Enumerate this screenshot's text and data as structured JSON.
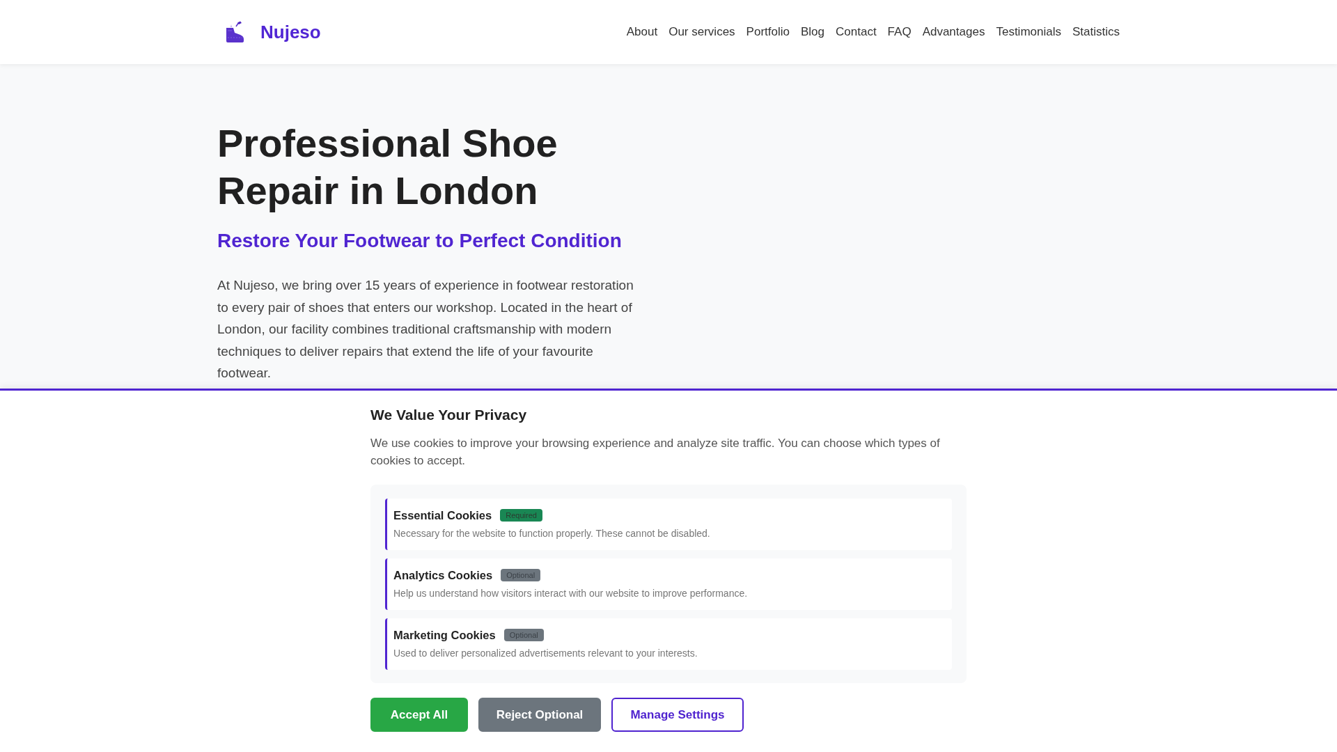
{
  "header": {
    "brand": "Nujeso",
    "nav": [
      {
        "label": "About"
      },
      {
        "label": "Our services"
      },
      {
        "label": "Portfolio"
      },
      {
        "label": "Blog"
      },
      {
        "label": "Contact"
      },
      {
        "label": "FAQ"
      },
      {
        "label": "Advantages"
      },
      {
        "label": "Testimonials"
      },
      {
        "label": "Statistics"
      }
    ]
  },
  "hero": {
    "title": "Professional Shoe Repair in London",
    "subtitle": "Restore Your Footwear to Perfect Condition",
    "description": "At Nujeso, we bring over 15 years of experience in footwear restoration to every pair of shoes that enters our workshop. Located in the heart of London, our facility combines traditional craftsmanship with modern techniques to deliver repairs that extend the life of your favourite footwear."
  },
  "cookie_banner": {
    "title": "We Value Your Privacy",
    "description": "We use cookies to improve your browsing experience and analyze site traffic. You can choose which types of cookies to accept.",
    "categories": [
      {
        "name": "Essential Cookies",
        "badge": "Required",
        "kind": "required",
        "description": "Necessary for the website to function properly. These cannot be disabled."
      },
      {
        "name": "Analytics Cookies",
        "badge": "Optional",
        "kind": "optional",
        "description": "Help us understand how visitors interact with our website to improve performance."
      },
      {
        "name": "Marketing Cookies",
        "badge": "Optional",
        "kind": "optional",
        "description": "Used to deliver personalized advertisements relevant to your interests."
      }
    ],
    "buttons": [
      {
        "label": "Accept All",
        "kind": "primary"
      },
      {
        "label": "Reject Optional",
        "kind": "secondary"
      },
      {
        "label": "Manage Settings",
        "kind": "outline"
      }
    ]
  }
}
